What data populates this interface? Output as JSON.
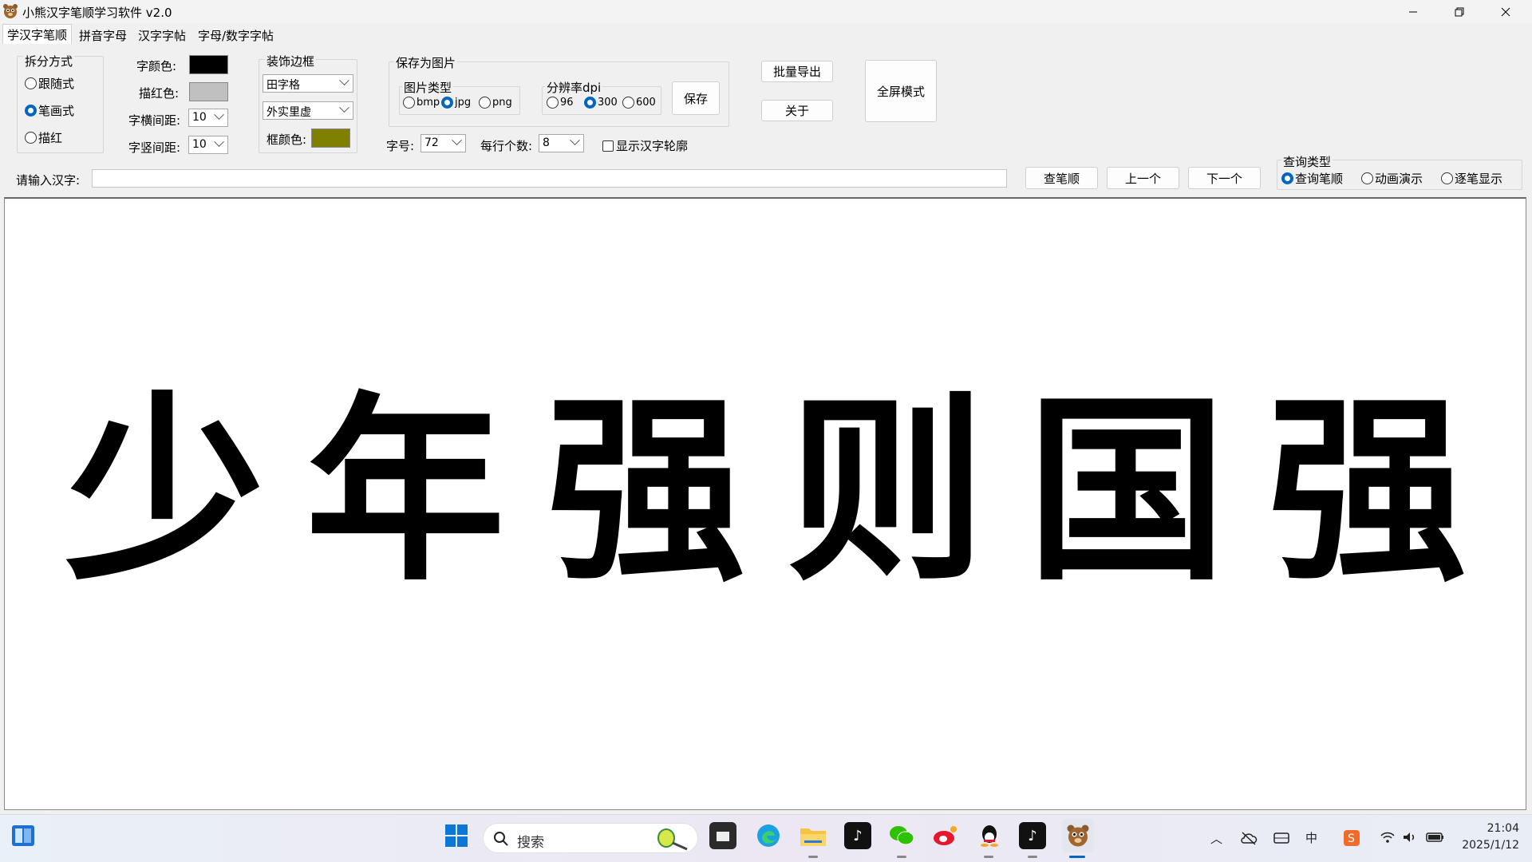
{
  "window": {
    "title": "小熊汉字笔顺学习软件 v2.0",
    "controls": [
      "minimize",
      "restore",
      "close"
    ]
  },
  "tabs": [
    {
      "label": "学汉字笔顺",
      "active": true
    },
    {
      "label": "拼音字母",
      "active": false
    },
    {
      "label": "汉字字帖",
      "active": false
    },
    {
      "label": "字母/数字字帖",
      "active": false
    }
  ],
  "split_mode": {
    "title": "拆分方式",
    "options": [
      {
        "label": "跟随式",
        "selected": false
      },
      {
        "label": "笔画式",
        "selected": true
      },
      {
        "label": "描红",
        "selected": false
      }
    ]
  },
  "colors": {
    "char_color_label": "字颜色:",
    "char_color": "#000000",
    "trace_color_label": "描红色:",
    "trace_color": "#c0c0c0",
    "h_spacing_label": "字横间距:",
    "h_spacing": "10",
    "v_spacing_label": "字竖间距:",
    "v_spacing": "10"
  },
  "border": {
    "title": "装饰边框",
    "grid_type": "田字格",
    "line_style": "外实里虚",
    "frame_color_label": "框颜色:",
    "frame_color": "#808000"
  },
  "save_image": {
    "title": "保存为图片",
    "type_title": "图片类型",
    "types": [
      {
        "label": "bmp",
        "selected": false
      },
      {
        "label": "jpg",
        "selected": true
      },
      {
        "label": "png",
        "selected": false
      }
    ],
    "dpi_title": "分辨率dpi",
    "dpis": [
      {
        "label": "96",
        "selected": false
      },
      {
        "label": "300",
        "selected": true
      },
      {
        "label": "600",
        "selected": false
      }
    ],
    "save_button": "保存"
  },
  "actions": {
    "batch_export": "批量导出",
    "about": "关于",
    "fullscreen": "全屏模式"
  },
  "font_row": {
    "size_label": "字号:",
    "size": "72",
    "per_row_label": "每行个数:",
    "per_row": "8",
    "outline_label": "显示汉字轮廓",
    "outline_checked": false
  },
  "input_row": {
    "label": "请输入汉字:",
    "value": "",
    "query_button": "查笔顺",
    "prev_button": "上一个",
    "next_button": "下一个"
  },
  "query_type": {
    "title": "查询类型",
    "options": [
      {
        "label": "查询笔顺",
        "selected": true
      },
      {
        "label": "动画演示",
        "selected": false
      },
      {
        "label": "逐笔显示",
        "selected": false
      }
    ]
  },
  "canvas": {
    "characters": [
      "少",
      "年",
      "强",
      "则",
      "国",
      "强"
    ]
  },
  "taskbar": {
    "search_placeholder": "搜索",
    "time": "21:04",
    "date": "2025/1/12",
    "ime_label": "中",
    "apps": [
      "file-explorer-icon",
      "edge-icon",
      "folder-icon",
      "tiktok-icon",
      "wechat-icon",
      "weibo-icon",
      "qq-icon",
      "tiktok2-icon",
      "bear-app-icon"
    ]
  }
}
